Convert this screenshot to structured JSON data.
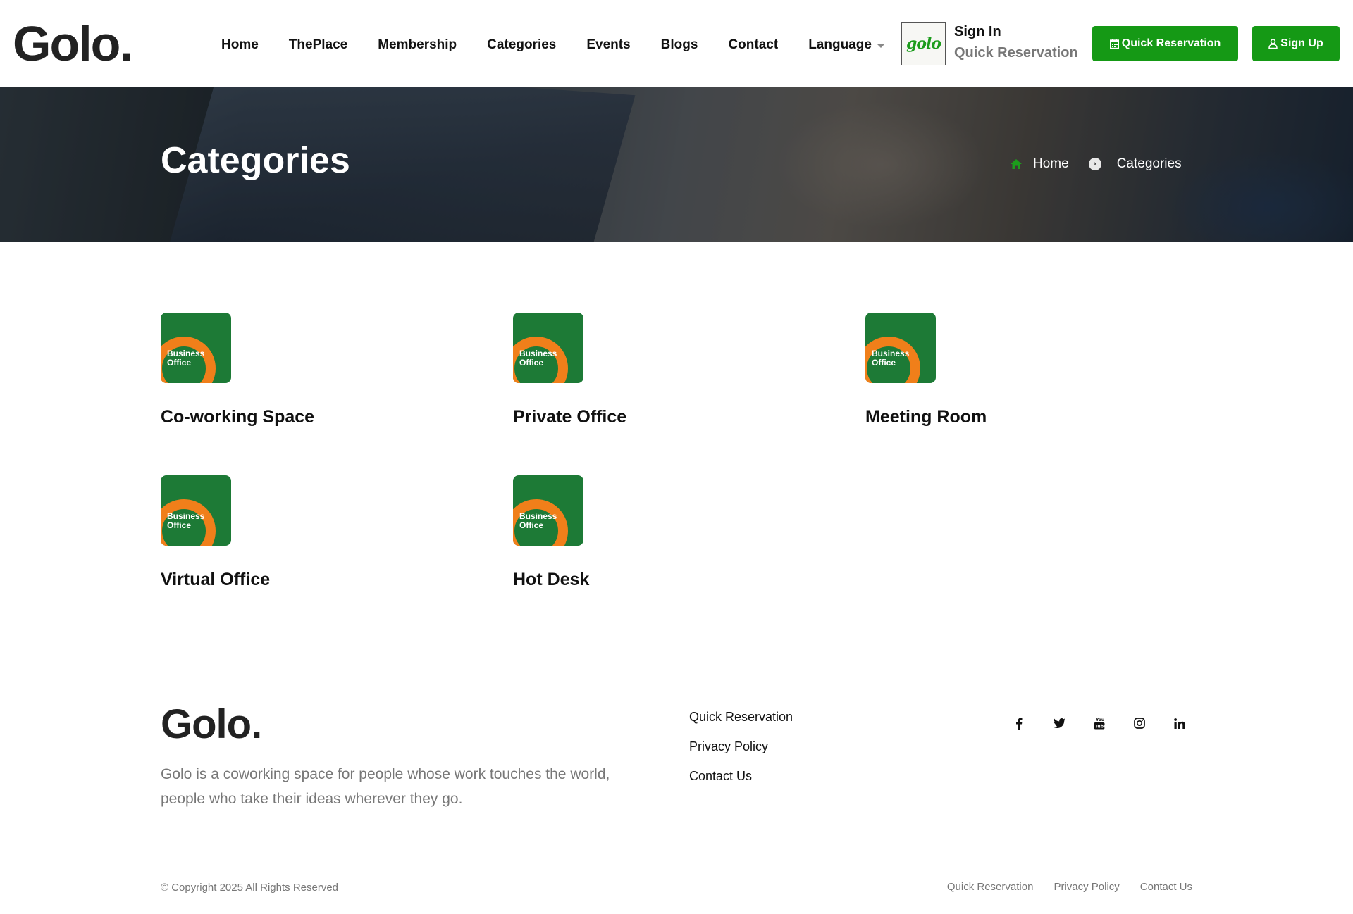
{
  "header": {
    "logo": "Golo.",
    "nav": [
      "Home",
      "ThePlace",
      "Membership",
      "Categories",
      "Events",
      "Blogs",
      "Contact"
    ],
    "language": "Language",
    "user_logo": "golo",
    "sign_in": "Sign In",
    "quick_reservation_link": "Quick Reservation",
    "quick_reservation_button": "Quick Reservation",
    "sign_up_button": "Sign Up"
  },
  "hero": {
    "title": "Categories",
    "breadcrumb": [
      "Home",
      "Categories"
    ]
  },
  "categories": [
    {
      "title": "Co-working Space",
      "thumb_line1": "Business",
      "thumb_line2": "Office"
    },
    {
      "title": "Private Office",
      "thumb_line1": "Business",
      "thumb_line2": "Office"
    },
    {
      "title": "Meeting Room",
      "thumb_line1": "Business",
      "thumb_line2": "Office"
    },
    {
      "title": "Virtual Office",
      "thumb_line1": "Business",
      "thumb_line2": "Office"
    },
    {
      "title": "Hot Desk",
      "thumb_line1": "Business",
      "thumb_line2": "Office"
    }
  ],
  "footer": {
    "logo": "Golo.",
    "description": "Golo is a coworking space for people whose work touches the world, people who take their ideas wherever they go.",
    "links": [
      "Quick Reservation",
      "Privacy Policy",
      "Contact Us"
    ],
    "socials": [
      "facebook-icon",
      "twitter-icon",
      "youtube-icon",
      "instagram-icon",
      "linkedin-icon"
    ],
    "copyright": "© Copyright 2025 All Rights Reserved",
    "bottom_links": [
      "Quick Reservation",
      "Privacy Policy",
      "Contact Us"
    ]
  },
  "colors": {
    "brand_green": "#159915",
    "thumb_green": "#1d7a36",
    "thumb_orange": "#f07f1a"
  }
}
